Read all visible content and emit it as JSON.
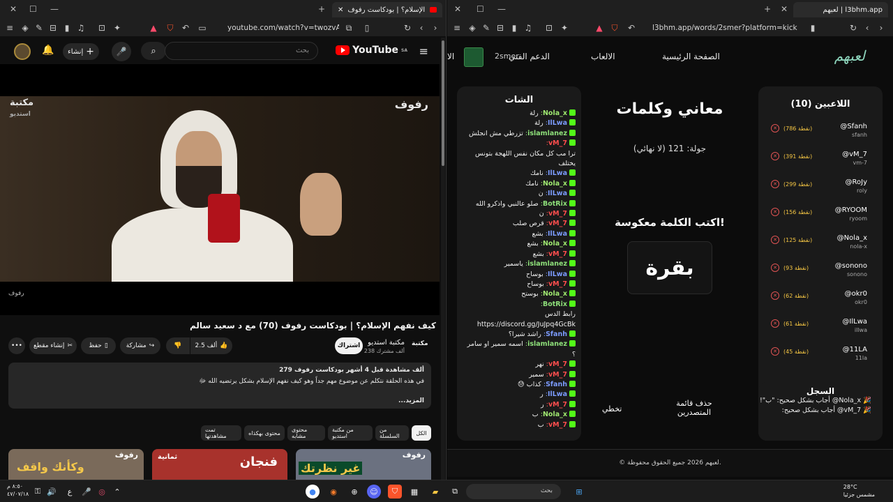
{
  "left_window": {
    "tab_title": "كيف نفهم الإسلام؟ | بودكاست رفوف",
    "url": "youtube.com/watch?v=twozvAUO6Qg",
    "yt": {
      "logo_text": "YouTube",
      "country": "SA",
      "search_placeholder": "بحث",
      "create_label": "إنشاء"
    },
    "video": {
      "watermark_right": "رفوف",
      "watermark_left": "مكتبة",
      "watermark_left_sub": "استديو",
      "bottom_label": "رفوف",
      "title": "كيف نفهم الإسلام؟ | بودكاست رفوف (70) مع د سعيد سالم"
    },
    "channel": {
      "name": "مكتبة استديو",
      "subs": "238 ألف مشترك",
      "logo": "مكتبة",
      "subscribe_label": "اشتراك"
    },
    "actions": {
      "likes": "2.5 ألف",
      "share": "مشاركة",
      "save": "حفظ",
      "clip": "إنشاء مقطع"
    },
    "description": {
      "meta": "279 ألف مشاهدة  قبل 4 أشهر  بودكاست رفوف",
      "text": "في هذه الحلقة نتكلم عن موضوع مهم جداً وهو كيف نفهم الإسلام بشكل يرتضيه الله ﷻ",
      "more": "...المزيد"
    },
    "chips": [
      "الكل",
      "من السلسلة",
      "من مكتبة استديو",
      "محتوى مشابه",
      "محتوى بهكذاه",
      "تمت مشاهدتها"
    ],
    "thumbs": [
      {
        "label": "رفوف",
        "text": "وكأنك واقف"
      },
      {
        "label": "ثمانية",
        "text": "فنجان"
      },
      {
        "label": "رفوف",
        "text": "غير نظرتك"
      }
    ]
  },
  "right_window": {
    "tab_title": "لعبهم | l3bhm.app",
    "url": "l3bhm.app/words/2smer?platform=kick",
    "nav": {
      "logo": "لعبهم",
      "home": "الصفحة الرئيسية",
      "games": "الالعاب",
      "support": "الدعم الفني",
      "username": "2smer",
      "edge": "الا"
    },
    "chat": {
      "title": "الشات",
      "messages": [
        {
          "user": "Nola_x",
          "color": "#9fe870",
          "text": "رلة"
        },
        {
          "user": "IlLwa",
          "color": "#7c9cff",
          "text": "رلة"
        },
        {
          "user": "islamlanez",
          "color": "#8ee07a",
          "text": "تزرطي مش انجلش"
        },
        {
          "user": "vM_7",
          "color": "#ff4d4d",
          "text": ""
        },
        {
          "user": "",
          "color": "#ffffff",
          "text": "ترا مب كل مكان نفس اللهجة بتونس يختلف"
        },
        {
          "user": "IlLwa",
          "color": "#7c9cff",
          "text": "نامك"
        },
        {
          "user": "Nola_x",
          "color": "#9fe870",
          "text": "نامك"
        },
        {
          "user": "IlLwa",
          "color": "#7c9cff",
          "text": "ن"
        },
        {
          "user": "BotRix",
          "color": "#8ee07a",
          "text": "صلو عالنبي واذكرو الله"
        },
        {
          "user": "vM_7",
          "color": "#ff4d4d",
          "text": "ن"
        },
        {
          "user": "vM_7",
          "color": "#ff4d4d",
          "text": "قرص صلب"
        },
        {
          "user": "IlLwa",
          "color": "#7c9cff",
          "text": "بشع"
        },
        {
          "user": "Nola_x",
          "color": "#9fe870",
          "text": "بشع"
        },
        {
          "user": "vM_7",
          "color": "#ff4d4d",
          "text": "بشع"
        },
        {
          "user": "islamlanez",
          "color": "#8ee07a",
          "text": "ياسمير"
        },
        {
          "user": "IlLwa",
          "color": "#7c9cff",
          "text": "بوساح"
        },
        {
          "user": "vM_7",
          "color": "#ff4d4d",
          "text": "بوساح"
        },
        {
          "user": "Nola_x",
          "color": "#9fe870",
          "text": "بوستح"
        },
        {
          "user": "BotRix",
          "color": "#8ee07a",
          "text": ""
        },
        {
          "user": "",
          "color": "#ffffff",
          "text": "رابط الدس https://discord.gg/JuJpq4GcBk"
        },
        {
          "user": "Sfanh",
          "color": "#7c9cff",
          "text": "راشد شيرا؟"
        },
        {
          "user": "islamlanez",
          "color": "#8ee07a",
          "text": "اسمه سمير او سامر ؟"
        },
        {
          "user": "vM_7",
          "color": "#ff4d4d",
          "text": "نهر"
        },
        {
          "user": "vM_7",
          "color": "#ff4d4d",
          "text": "سمير"
        },
        {
          "user": "Sfanh",
          "color": "#7c9cff",
          "text": "كذاب 😓"
        },
        {
          "user": "IlLwa",
          "color": "#7c9cff",
          "text": "ر"
        },
        {
          "user": "vM_7",
          "color": "#ff4d4d",
          "text": "ر"
        },
        {
          "user": "Nola_x",
          "color": "#9fe870",
          "text": "ب"
        },
        {
          "user": "vM_7",
          "color": "#ff4d4d",
          "text": "ب"
        }
      ]
    },
    "center": {
      "title": "معاني وكلمات",
      "round": "جولة: 121 (لا نهائي)",
      "prompt": "اكتب الكلمة معكوسة!",
      "word": "بقرة",
      "skip_label": "تخطي",
      "clear_leaders_label": "حذف قائمة المتصدرين"
    },
    "players": {
      "title": "اللاعبين (10)",
      "list": [
        {
          "name": "@Sfanh",
          "handle": "sfanh",
          "points": "(786 نقطة)"
        },
        {
          "name": "@vM_7",
          "handle": "vm-7",
          "points": "(391 نقطة)"
        },
        {
          "name": "@RoJy",
          "handle": "roly",
          "points": "(299 نقطة)"
        },
        {
          "name": "@RYOOM",
          "handle": "ryoom",
          "points": "(156 نقطة)"
        },
        {
          "name": "@Nola_x",
          "handle": "nola-x",
          "points": "(125 نقطة)"
        },
        {
          "name": "@sonono",
          "handle": "sonono",
          "points": "(93 نقطة)"
        },
        {
          "name": "@okr0",
          "handle": "okr0",
          "points": "(62 نقطة)"
        },
        {
          "name": "@IlLwa",
          "handle": "illwa",
          "points": "(61 نقطة)"
        },
        {
          "name": "@11LA",
          "handle": "11la",
          "points": "(45 نقطة)"
        }
      ]
    },
    "log": {
      "title": "السجل",
      "lines": [
        "🎉 Nola_x@ أجاب بشكل صحيح: \"ب\"!",
        "🎉 vM_7@ أجاب بشكل صحيح:"
      ]
    },
    "footer": "© لعبهم 2026 جميع الحقوق محفوظة."
  },
  "taskbar": {
    "search": "بحث",
    "time": "٨:٥٠ م",
    "date": "٤٧/٠٧/١٨",
    "lang": "ع",
    "temp": "28°C",
    "weather": "مشمس جزئيا"
  }
}
